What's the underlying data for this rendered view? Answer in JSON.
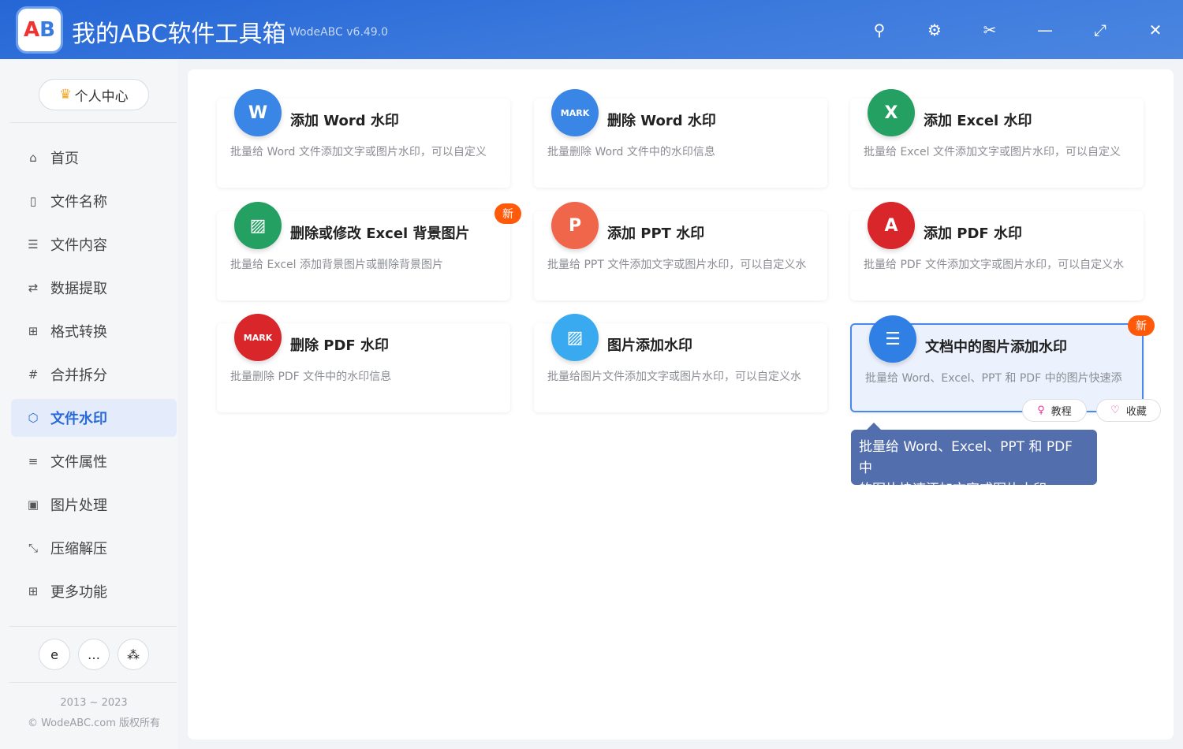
{
  "header": {
    "app_title": "我的ABC软件工具箱",
    "version": "WodeABC v6.49.0",
    "logo_text": "AB"
  },
  "sidebar": {
    "user_center": "个人中心",
    "items": [
      {
        "label": "首页",
        "icon": "home-icon",
        "glyph": "⌂"
      },
      {
        "label": "文件名称",
        "icon": "file-name-icon",
        "glyph": "▯"
      },
      {
        "label": "文件内容",
        "icon": "file-content-icon",
        "glyph": "☰"
      },
      {
        "label": "数据提取",
        "icon": "data-extract-icon",
        "glyph": "⇄"
      },
      {
        "label": "格式转换",
        "icon": "format-convert-icon",
        "glyph": "⊞"
      },
      {
        "label": "合并拆分",
        "icon": "merge-split-icon",
        "glyph": "#"
      },
      {
        "label": "文件水印",
        "icon": "watermark-icon",
        "glyph": "⬡"
      },
      {
        "label": "文件属性",
        "icon": "file-properties-icon",
        "glyph": "≡"
      },
      {
        "label": "图片处理",
        "icon": "image-icon",
        "glyph": "▣"
      },
      {
        "label": "压缩解压",
        "icon": "compress-icon",
        "glyph": "⤡"
      },
      {
        "label": "更多功能",
        "icon": "more-icon",
        "glyph": "⊞"
      }
    ],
    "active_index": 6,
    "copyright_years": "2013 ~ 2023",
    "copyright": "© WodeABC.com 版权所有"
  },
  "cards": [
    {
      "title": "添加 Word 水印",
      "desc": "批量给 Word 文件添加文字或图片水印，可以自定义",
      "color": "#3a86e6",
      "glyph": "W"
    },
    {
      "title": "删除 Word 水印",
      "desc": "批量删除 Word 文件中的水印信息",
      "color": "#3a86e6",
      "glyph": "MARK"
    },
    {
      "title": "添加 Excel 水印",
      "desc": "批量给 Excel 文件添加文字或图片水印，可以自定义",
      "color": "#23a062",
      "glyph": "X"
    },
    {
      "title": "删除或修改 Excel 背景图片",
      "desc": "批量给 Excel 添加背景图片或删除背景图片",
      "color": "#23a062",
      "glyph": "▨",
      "badge": "新"
    },
    {
      "title": "添加 PPT 水印",
      "desc": "批量给 PPT 文件添加文字或图片水印，可以自定义水",
      "color": "#f0664a",
      "glyph": "P"
    },
    {
      "title": "添加 PDF 水印",
      "desc": "批量给 PDF 文件添加文字或图片水印，可以自定义水",
      "color": "#d8262a",
      "glyph": "A"
    },
    {
      "title": "删除 PDF 水印",
      "desc": "批量删除 PDF 文件中的水印信息",
      "color": "#d8262a",
      "glyph": "MARK"
    },
    {
      "title": "图片添加水印",
      "desc": "批量给图片文件添加文字或图片水印，可以自定义水",
      "color": "#3aaaf0",
      "glyph": "▨"
    },
    {
      "title": "文档中的图片添加水印",
      "desc": "批量给 Word、Excel、PPT 和 PDF 中的图片快速添",
      "color": "#2f7fe4",
      "glyph": "☰",
      "badge": "新"
    }
  ],
  "card_actions": {
    "tutorial": "教程",
    "favorite": "收藏"
  },
  "tooltip": {
    "line1": "批量给 Word、Excel、PPT 和 PDF 中",
    "line2": "的图片快速添加文字或图片水印"
  }
}
